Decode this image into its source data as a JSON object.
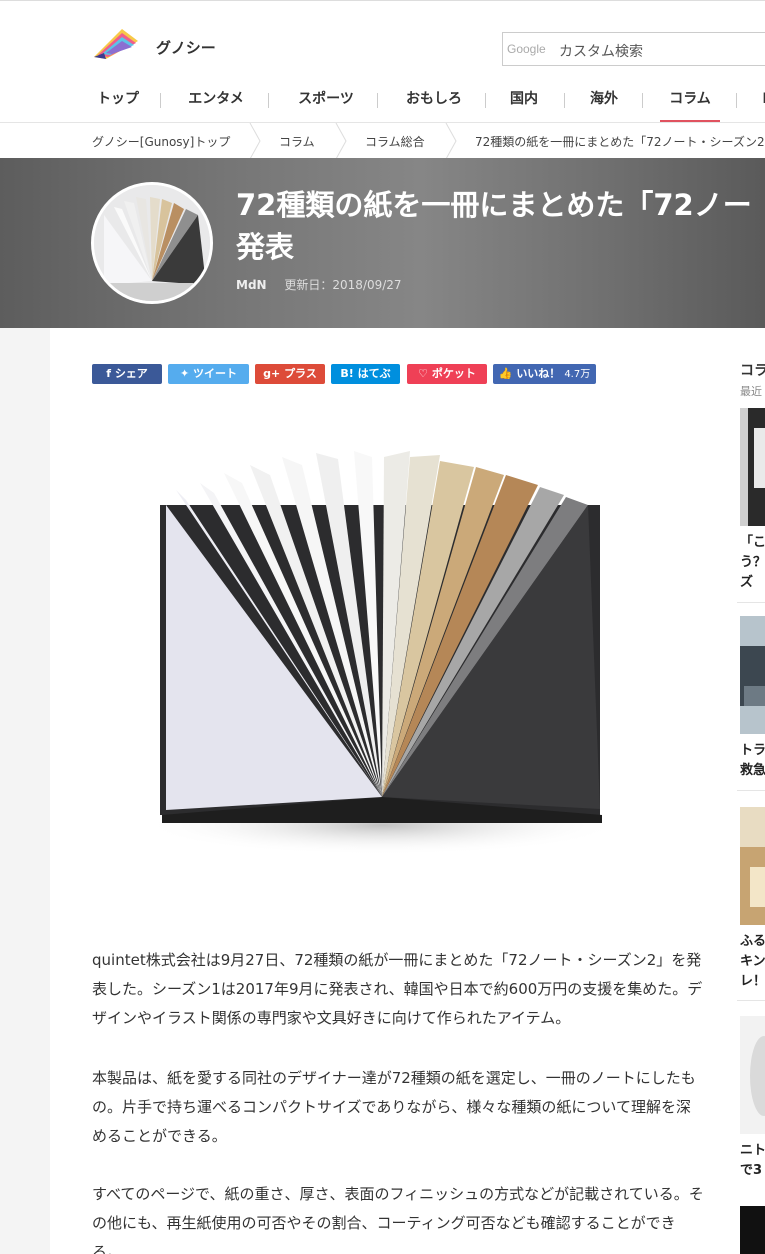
{
  "header": {
    "brand": "グノシー",
    "search": {
      "google_mark": "Google",
      "placeholder": "カスタム検索"
    }
  },
  "nav": {
    "items": [
      {
        "label": "トップ"
      },
      {
        "label": "エンタメ"
      },
      {
        "label": "スポーツ"
      },
      {
        "label": "おもしろ"
      },
      {
        "label": "国内"
      },
      {
        "label": "海外"
      },
      {
        "label": "コラム",
        "active": true
      },
      {
        "label": "I"
      }
    ]
  },
  "breadcrumb": [
    "グノシー[Gunosy]トップ",
    "コラム",
    "コラム総合",
    "72種類の紙を一冊にまとめた「72ノート・シーズン2」"
  ],
  "article": {
    "title_line1": "72種類の紙を一冊にまとめた「72ノー",
    "title_line2": "発表",
    "source": "MdN",
    "updated": "更新日：2018/09/27",
    "paragraphs": [
      "quintet株式会社は9月27日、72種類の紙が一冊にまとめた「72ノート・シーズン2」を発表した。シーズン1は2017年9月に発表され、韓国や日本で約600万円の支援を集めた。デザインやイラスト関係の専門家や文具好きに向けて作られたアイテム。",
      "本製品は、紙を愛する同社のデザイナー達が72種類の紙を選定し、一冊のノートにしたもの。片手で持ち運べるコンパクトサイズでありながら、様々な種類の紙について理解を深めることができる。",
      "すべてのページで、紙の重さ、厚さ、表面のフィニッシュの方式などが記載されている。その他にも、再生紙使用の可否やその割合、コーティング可否なども確認することができる。"
    ]
  },
  "share": [
    {
      "label": "シェア",
      "icon": "facebook-icon",
      "color": "#3b5998"
    },
    {
      "label": "ツイート",
      "icon": "twitter-icon",
      "color": "#55acee"
    },
    {
      "label": "プラス",
      "icon": "google-plus-icon",
      "color": "#dd4b39"
    },
    {
      "label": "はてぶ",
      "icon": "hatena-icon",
      "color": "#008fde"
    },
    {
      "label": "ポケット",
      "icon": "pocket-icon",
      "color": "#ef4056"
    },
    {
      "label": "いいね！",
      "count": "4.7万",
      "icon": "like-icon",
      "color": "#4267b2"
    }
  ],
  "sidebar": {
    "heading": "コラ",
    "sub": "最近",
    "items": [
      {
        "title": "「こう？ズ"
      },
      {
        "title": "トラ救急"
      },
      {
        "title": "ふるキンレ！"
      },
      {
        "title": "ニトで3"
      }
    ]
  },
  "colors": {
    "accent": "#e0525f"
  }
}
